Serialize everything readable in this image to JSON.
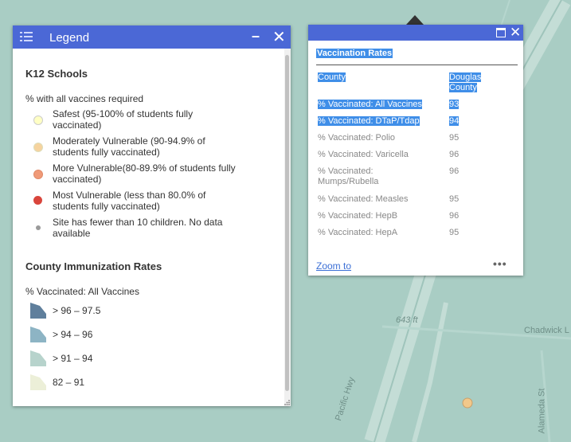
{
  "map": {
    "labels": {
      "pacific_hwy": "Pacific Hwy",
      "elevation": "643 ft",
      "chadwick": "Chadwick L",
      "alameda": "Alameda St"
    },
    "colors": {
      "background": "#a9cdc4",
      "road": "#c4ddd6",
      "school_dot": "#f2c88a"
    }
  },
  "legend": {
    "title": "Legend",
    "k12": {
      "heading": "K12 Schools",
      "subheading": "% with all vaccines required",
      "items": [
        {
          "label": "Safest (95-100% of students fully vaccinated)",
          "color": "#ffffc4"
        },
        {
          "label": "Moderately Vulnerable (90-94.9% of students fully vaccinated)",
          "color": "#f6d39e"
        },
        {
          "label": "More Vulnerable(80-89.9% of students fully vaccinated)",
          "color": "#f09a78"
        },
        {
          "label": "Most Vulnerable (less than 80.0% of students fully vaccinated)",
          "color": "#d9453c"
        },
        {
          "label": "Site has fewer than 10 children. No data available",
          "color": "#9a9a9a"
        }
      ]
    },
    "county": {
      "heading": "County Immunization Rates",
      "subheading": "% Vaccinated: All Vaccines",
      "items": [
        {
          "label": "> 96 – 97.5",
          "color": "#5f7f9c"
        },
        {
          "label": "> 94 – 96",
          "color": "#8db4c4"
        },
        {
          "label": "> 91 – 94",
          "color": "#b7d3cc"
        },
        {
          "label": "82 – 91",
          "color": "#ecefd8"
        }
      ]
    }
  },
  "popup": {
    "title": "Vaccination Rates",
    "header": {
      "field": "County",
      "value": "Douglas County"
    },
    "rows": [
      {
        "field": "% Vaccinated: All Vaccines",
        "value": "93",
        "highlight": true
      },
      {
        "field": "% Vaccinated: DTaP/Tdap",
        "value": "94",
        "highlight": true
      },
      {
        "field": "% Vaccinated: Polio",
        "value": "95"
      },
      {
        "field": "% Vaccinated: Varicella",
        "value": "96"
      },
      {
        "field": "% Vaccinated: Mumps/Rubella",
        "value": "96"
      },
      {
        "field": "% Vaccinated: Measles",
        "value": "95"
      },
      {
        "field": "% Vaccinated: HepB",
        "value": "96"
      },
      {
        "field": "% Vaccinated: HepA",
        "value": "95"
      }
    ],
    "zoom_label": "Zoom to",
    "more_label": "•••"
  }
}
